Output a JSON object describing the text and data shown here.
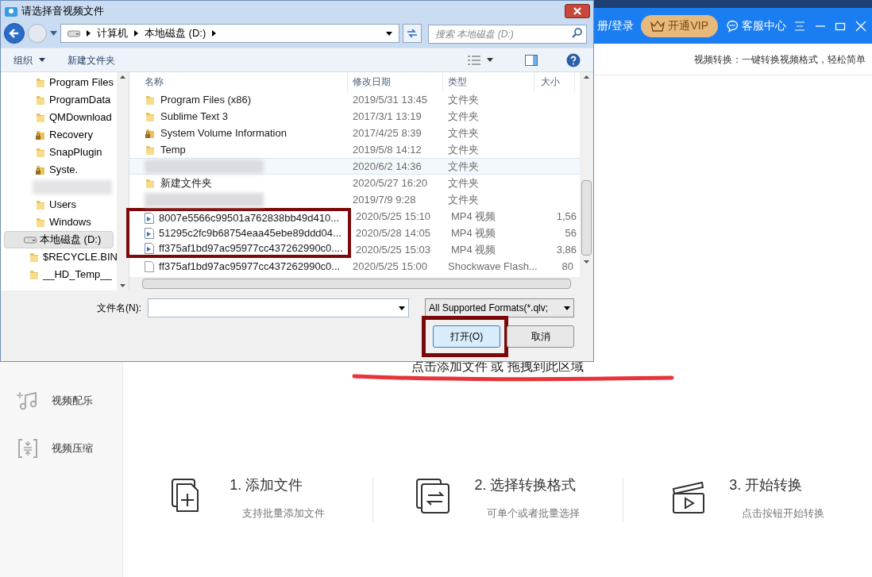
{
  "app": {
    "header": {
      "login": "册/登录",
      "vip": "开通VIP",
      "service": "客服中心"
    },
    "tagline": "视频转换：一键转换视频格式，轻松简单",
    "sidebar": [
      {
        "label": "视频配乐"
      },
      {
        "label": "视频压缩"
      }
    ],
    "drop_hint": {
      "text": "点击添加文件 或 拖拽到此区域",
      "underlined": true
    },
    "steps": [
      {
        "title": "1. 添加文件",
        "subtitle": "支持批量添加文件"
      },
      {
        "title": "2. 选择转换格式",
        "subtitle": "可单个或者批量选择"
      },
      {
        "title": "3. 开始转换",
        "subtitle": "点击按钮开始转换"
      }
    ]
  },
  "dialog": {
    "title": "请选择音视频文件",
    "breadcrumb": [
      "计算机",
      "本地磁盘 (D:)"
    ],
    "search": {
      "placeholder": "搜索 本地磁盘 (D:)"
    },
    "toolbar": [
      "组织",
      "新建文件夹"
    ],
    "tree": [
      {
        "label": "Program Files",
        "kind": "folder",
        "selected": false
      },
      {
        "label": "ProgramData",
        "kind": "folder",
        "selected": false
      },
      {
        "label": "QMDownload",
        "kind": "folder",
        "selected": false
      },
      {
        "label": "Recovery",
        "kind": "locked",
        "selected": false
      },
      {
        "label": "SnapPlugin",
        "kind": "folder",
        "selected": false
      },
      {
        "label": "Syste.",
        "kind": "locked",
        "selected": false
      },
      {
        "kind": "blurred"
      },
      {
        "label": "Users",
        "kind": "folder",
        "selected": false
      },
      {
        "label": "Windows",
        "kind": "folder",
        "selected": false
      },
      {
        "label": "本地磁盘 (D:)",
        "kind": "drive",
        "selected": true,
        "children": [
          {
            "label": "$RECYCLE.BIN",
            "kind": "folder",
            "selected": false
          },
          {
            "label": "__HD_Temp__",
            "kind": "folder",
            "selected": false
          }
        ]
      }
    ],
    "columns": [
      "名称",
      "修改日期",
      "类型",
      "大小"
    ],
    "files": [
      {
        "name": "Program Files (x86)",
        "date": "2019/5/31 13:45",
        "type": "文件夹",
        "kind": "folder",
        "hovered": false,
        "marked": false
      },
      {
        "name": "Sublime Text 3",
        "date": "2017/3/1 13:19",
        "type": "文件夹",
        "kind": "folder",
        "hovered": false,
        "marked": false
      },
      {
        "name": "System Volume Information",
        "date": "2017/4/25 8:39",
        "type": "文件夹",
        "kind": "locked",
        "hovered": false,
        "marked": false
      },
      {
        "name": "Temp",
        "date": "2019/5/8 14:12",
        "type": "文件夹",
        "kind": "folder",
        "hovered": false,
        "marked": false
      },
      {
        "date": "2020/6/2 14:36",
        "type": "文件夹",
        "kind": "blurred",
        "hovered": true,
        "marked": false
      },
      {
        "name": "新建文件夹",
        "date": "2020/5/27 16:20",
        "type": "文件夹",
        "kind": "folder",
        "hovered": false,
        "marked": false
      },
      {
        "date": "2019/7/9 9:28",
        "type": "文件夹",
        "kind": "blurred",
        "hovered": false,
        "marked": false
      },
      {
        "name": "8007e5566c99501a762838bb49d410...",
        "date": "2020/5/25 15:10",
        "type": "MP4 视频",
        "size": "1,56",
        "kind": "video",
        "hovered": false,
        "marked": true
      },
      {
        "name": "51295c2fc9b68754eaa45ebe89ddd04...",
        "date": "2020/5/28 14:05",
        "type": "MP4 视频",
        "size": "56",
        "kind": "video",
        "hovered": false,
        "marked": true
      },
      {
        "name": "ff375af1bd97ac95977cc437262990c0....",
        "date": "2020/5/25 15:03",
        "type": "MP4 视频",
        "size": "3,86",
        "kind": "video",
        "hovered": false,
        "marked": true
      },
      {
        "name": "ff375af1bd97ac95977cc437262990c0...",
        "date": "2020/5/25 15:00",
        "type": "Shockwave Flash...",
        "size": "80",
        "kind": "flash",
        "hovered": false,
        "marked": false
      }
    ],
    "filename_label": "文件名(N):",
    "filter": "All Supported Formats(*.qlv;",
    "buttons": [
      {
        "label": "打开(O)",
        "default": true,
        "marked": true
      },
      {
        "label": "取消",
        "default": false,
        "marked": false
      }
    ]
  }
}
